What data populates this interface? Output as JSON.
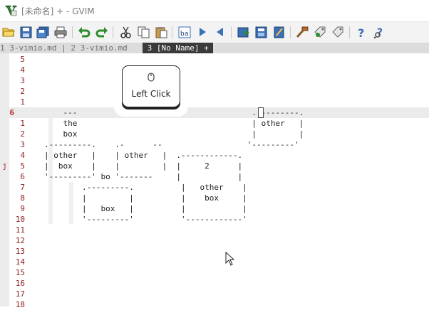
{
  "window": {
    "title": "[未命名] + - GVIM"
  },
  "toolbar": {
    "buttons": [
      {
        "name": "open-icon"
      },
      {
        "name": "save-icon"
      },
      {
        "name": "save-all-icon"
      },
      {
        "name": "print-icon"
      },
      {
        "name": "undo-icon"
      },
      {
        "name": "redo-icon"
      },
      {
        "name": "cut-icon"
      },
      {
        "name": "copy-icon"
      },
      {
        "name": "paste-icon"
      },
      {
        "name": "find-replace-icon"
      },
      {
        "name": "find-next-icon"
      },
      {
        "name": "find-prev-icon"
      },
      {
        "name": "load-session-icon"
      },
      {
        "name": "save-session-icon"
      },
      {
        "name": "run-script-icon"
      },
      {
        "name": "make-icon"
      },
      {
        "name": "run-ctags-icon"
      },
      {
        "name": "jump-tag-icon"
      },
      {
        "name": "help-icon"
      },
      {
        "name": "find-help-icon"
      }
    ]
  },
  "tabline": {
    "tab1": "1 3-vimio.md | 2 3-vimio.md ",
    "tab3": " 3 [No Name] + "
  },
  "editor": {
    "gutter_mark": "j",
    "lines": [
      {
        "num": "5",
        "text": ""
      },
      {
        "num": "4",
        "text": ""
      },
      {
        "num": "3",
        "text": ""
      },
      {
        "num": "2",
        "text": ""
      },
      {
        "num": "1",
        "text": ""
      },
      {
        "num": "6",
        "text": "    ---                                     .---------.",
        "current": true
      },
      {
        "num": "1",
        "text": "    the                                     | other   |"
      },
      {
        "num": "2",
        "text": "    box                                     |         |"
      },
      {
        "num": "3",
        "text": ".---------.    .-      --                  '---------'"
      },
      {
        "num": "4",
        "text": "| other   |    | other   |  .------------."
      },
      {
        "num": "5",
        "text": "|  box    |    |         |  |     2      |"
      },
      {
        "num": "6",
        "text": "'---------' bo '-------     |            |"
      },
      {
        "num": "7",
        "text": "        .---------.          |   other    |"
      },
      {
        "num": "8",
        "text": "        |         |          |    box     |"
      },
      {
        "num": "9",
        "text": "        |   box   |          |            |"
      },
      {
        "num": "10",
        "text": "        '---------'          '------------'"
      },
      {
        "num": "11",
        "text": ""
      },
      {
        "num": "12",
        "text": ""
      },
      {
        "num": "13",
        "text": ""
      },
      {
        "num": "14",
        "text": ""
      },
      {
        "num": "15",
        "text": ""
      },
      {
        "num": "16",
        "text": ""
      },
      {
        "num": "17",
        "text": ""
      },
      {
        "num": "18",
        "text": ""
      }
    ]
  },
  "tooltip": {
    "label": "Left Click",
    "icon": "mouse-icon"
  },
  "colors": {
    "line_number": "#8b1e1e",
    "tab_selected_bg": "#3a3a3a",
    "tabline_bg": "#dcdcdc",
    "current_line_bg": "#ebebeb"
  }
}
